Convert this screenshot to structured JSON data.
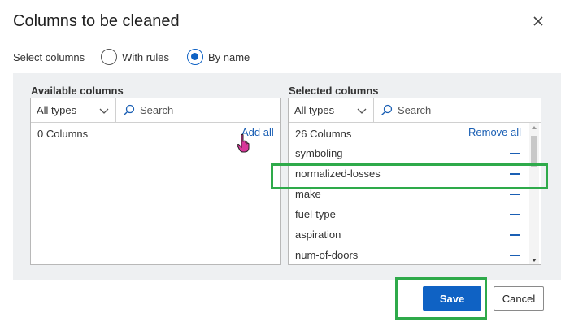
{
  "dialog": {
    "title": "Columns to be cleaned"
  },
  "select_columns": {
    "label": "Select columns",
    "options": [
      {
        "label": "With rules",
        "checked": false
      },
      {
        "label": "By name",
        "checked": true
      }
    ]
  },
  "available": {
    "heading": "Available columns",
    "type_filter": "All types",
    "search_placeholder": "Search",
    "count": "0 Columns",
    "action": "Add all"
  },
  "selected": {
    "heading": "Selected columns",
    "type_filter": "All types",
    "search_placeholder": "Search",
    "count": "26 Columns",
    "action": "Remove all",
    "items": [
      "symboling",
      "normalized-losses",
      "make",
      "fuel-type",
      "aspiration",
      "num-of-doors"
    ]
  },
  "buttons": {
    "save": "Save",
    "cancel": "Cancel"
  },
  "colors": {
    "accent": "#0f62c4",
    "highlight": "#2eaa4a",
    "link": "#1a5fb4"
  }
}
